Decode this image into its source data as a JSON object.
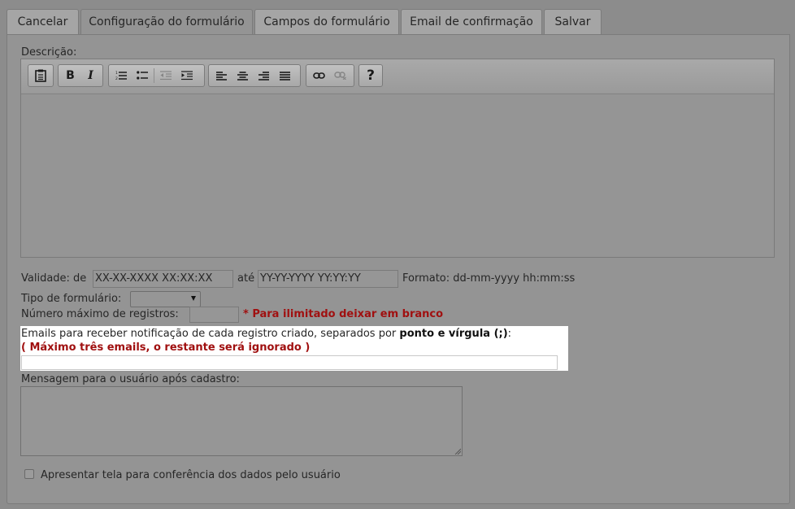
{
  "tabs": [
    {
      "label": "Cancelar"
    },
    {
      "label": "Configuração do formulário"
    },
    {
      "label": "Campos do formulário"
    },
    {
      "label": "Email de confirmação"
    },
    {
      "label": "Salvar"
    }
  ],
  "descricao_label": "Descrição:",
  "toolbar": {
    "paste_icon": "paste-icon",
    "bold": "B",
    "italic": "I",
    "help": "?"
  },
  "validade": {
    "label": "Validade: de",
    "from_value": "XX-XX-XXXX XX:XX:XX",
    "ate": "até",
    "to_value": "YY-YY-YYYY YY:YY:YY",
    "formato": "Formato: dd-mm-yyyy hh:mm:ss"
  },
  "tipo_label": "Tipo de formulário:",
  "tipo_value": "",
  "max_label": "Número máximo de registros:",
  "max_value": "",
  "max_hint": "* Para ilimitado deixar em branco",
  "emails": {
    "label_pre": "Emails para receber notificação de cada registro criado, separados por",
    "label_bold": "ponto e vírgula (;)",
    "label_post": ":",
    "warning": "( Máximo três emails, o restante será ignorado )",
    "value": ""
  },
  "mensagem_label": "Mensagem para o usuário após cadastro:",
  "mensagem_value": "",
  "conferencia_label": "Apresentar tela para conferência dos dados pelo usuário",
  "colors": {
    "background": "#8c8c8c",
    "panel": "#949494",
    "warning": "#a01010",
    "highlight": "#ffffff"
  }
}
